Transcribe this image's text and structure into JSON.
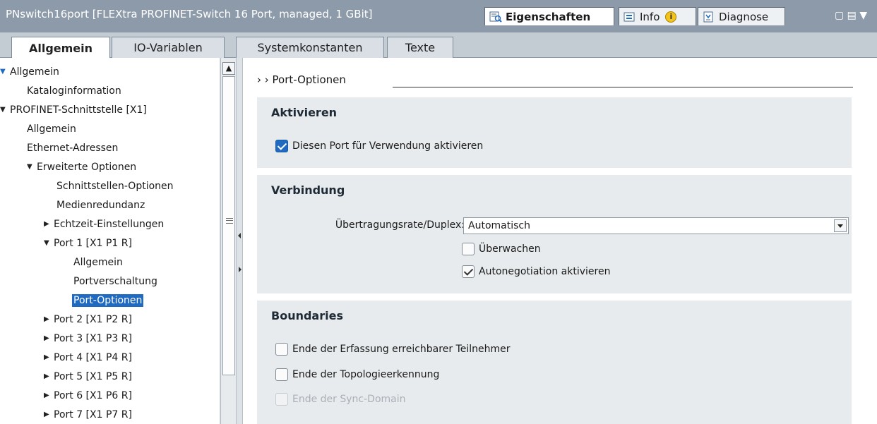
{
  "title_bar": {
    "window_title": "PNswitch16port [FLEXtra PROFINET-Switch 16 Port, managed, 1 GBit]",
    "inspector_tabs": [
      {
        "label": "Eigenschaften",
        "active": true,
        "icon": "properties-icon"
      },
      {
        "label": "Info",
        "active": false,
        "icon": "info-icon"
      },
      {
        "label": "Diagnose",
        "active": false,
        "icon": "diagnostics-icon"
      }
    ],
    "window_controls": "▢ ▤ ▼"
  },
  "main_tabs": [
    {
      "label": "Allgemein",
      "active": true
    },
    {
      "label": "IO-Variablen",
      "active": false
    },
    {
      "label": "Systemkonstanten",
      "active": false
    },
    {
      "label": "Texte",
      "active": false
    }
  ],
  "tree": {
    "items": [
      {
        "label": "Allgemein",
        "expander": "▼",
        "selected": false
      },
      {
        "label": "Kataloginformation",
        "expander": "",
        "selected": false
      },
      {
        "label": "PROFINET-Schnittstelle [X1]",
        "expander": "▼",
        "selected": false
      },
      {
        "label": "Allgemein",
        "expander": "",
        "selected": false
      },
      {
        "label": "Ethernet-Adressen",
        "expander": "",
        "selected": false
      },
      {
        "label": "Erweiterte Optionen",
        "expander": "▼",
        "selected": false
      },
      {
        "label": "Schnittstellen-Optionen",
        "expander": "",
        "selected": false
      },
      {
        "label": "Medienredundanz",
        "expander": "",
        "selected": false
      },
      {
        "label": "Echtzeit-Einstellungen",
        "expander": "▶",
        "selected": false
      },
      {
        "label": "Port 1 [X1 P1 R]",
        "expander": "▼",
        "selected": false
      },
      {
        "label": "Allgemein",
        "expander": "",
        "selected": false
      },
      {
        "label": "Portverschaltung",
        "expander": "",
        "selected": false
      },
      {
        "label": "Port-Optionen",
        "expander": "",
        "selected": true
      },
      {
        "label": "Port 2 [X1 P2 R]",
        "expander": "▶",
        "selected": false
      },
      {
        "label": "Port 3 [X1 P3 R]",
        "expander": "▶",
        "selected": false
      },
      {
        "label": "Port 4 [X1 P4 R]",
        "expander": "▶",
        "selected": false
      },
      {
        "label": "Port 5 [X1 P5 R]",
        "expander": "▶",
        "selected": false
      },
      {
        "label": "Port 6 [X1 P6 R]",
        "expander": "▶",
        "selected": false
      },
      {
        "label": "Port 7 [X1 P7 R]",
        "expander": "▶",
        "selected": false
      }
    ]
  },
  "content": {
    "breadcrumb": "› ›   Port-Optionen",
    "aktivieren": {
      "title": "Aktivieren",
      "port_enable_label": "Diesen Port für Verwendung aktivieren",
      "port_enable_checked": true
    },
    "verbindung": {
      "title": "Verbindung",
      "rate_label": "Übertragungsrate/Duplex:",
      "rate_value": "Automatisch",
      "monitor_label": "Überwachen",
      "monitor_checked": false,
      "autoneg_label": "Autonegotiation aktivieren",
      "autoneg_checked": true
    },
    "boundaries": {
      "title": "Boundaries",
      "end_detection_label": "Ende der Erfassung erreichbarer Teilnehmer",
      "end_detection_checked": false,
      "end_topology_label": "Ende der Topologieerkennung",
      "end_topology_checked": false,
      "end_sync_label": "Ende der Sync-Domain",
      "end_sync_checked": false,
      "end_sync_disabled": true
    }
  }
}
